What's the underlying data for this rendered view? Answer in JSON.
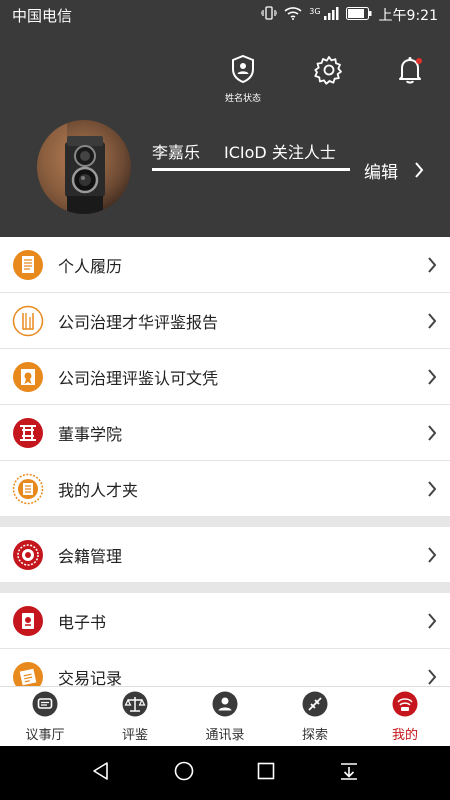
{
  "status_bar": {
    "carrier": "中国电信",
    "network": "3G",
    "time": "上午9:21"
  },
  "header": {
    "status_label": "姓名状态",
    "user_name": "李嘉乐",
    "user_title": "ICIoD 关注人士",
    "edit_label": "编辑"
  },
  "menu": {
    "items": [
      {
        "label": "个人履历",
        "icon": "resume-icon"
      },
      {
        "label": "公司治理才华评鉴报告",
        "icon": "report-icon"
      },
      {
        "label": "公司治理评鉴认可文凭",
        "icon": "certificate-icon"
      },
      {
        "label": "董事学院",
        "icon": "academy-icon"
      },
      {
        "label": "我的人才夹",
        "icon": "talent-folder-icon"
      },
      {
        "label": "会籍管理",
        "icon": "membership-icon"
      },
      {
        "label": "电子书",
        "icon": "ebook-icon"
      },
      {
        "label": "交易记录",
        "icon": "transaction-icon"
      }
    ]
  },
  "tabs": [
    {
      "label": "议事厅",
      "icon": "chat-icon",
      "active": false
    },
    {
      "label": "评鉴",
      "icon": "scale-icon",
      "active": false
    },
    {
      "label": "通讯录",
      "icon": "contacts-icon",
      "active": false
    },
    {
      "label": "探索",
      "icon": "explore-icon",
      "active": false
    },
    {
      "label": "我的",
      "icon": "profile-icon",
      "active": true
    }
  ],
  "colors": {
    "header_bg": "#3a3a3a",
    "accent_red": "#c4161c",
    "accent_orange": "#e8891d"
  }
}
